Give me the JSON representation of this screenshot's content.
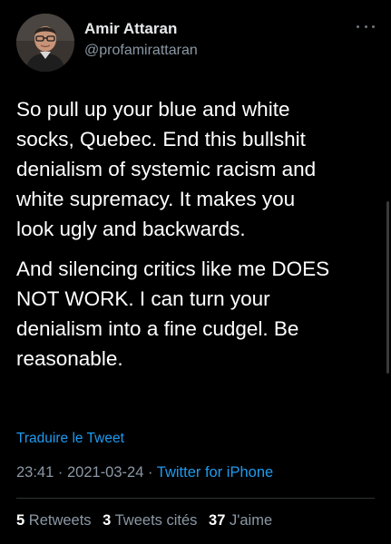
{
  "author": {
    "name": "Amir Attaran",
    "handle": "@profamirattaran"
  },
  "tweet": {
    "paragraphs": [
      "So pull up your blue and white\nsocks, Quebec.  End this bullshit\ndenialism of systemic racism and\nwhite supremacy.  It makes you\nlook ugly and backwards.",
      "And silencing critics like me DOES\nNOT WORK.  I can turn your\ndenialism into a fine cudgel.  Be\nreasonable."
    ],
    "translate_label": "Traduire le Tweet",
    "time": "23:41",
    "date": "2021-03-24",
    "separator": "·",
    "source": "Twitter for iPhone"
  },
  "stats": {
    "retweets_count": "5",
    "retweets_label": "Retweets",
    "quotes_count": "3",
    "quotes_label": "Tweets cités",
    "likes_count": "37",
    "likes_label": "J'aime"
  },
  "colors": {
    "background": "#000000",
    "text": "#ffffff",
    "muted": "#8b98a5",
    "link": "#1d9bf0"
  },
  "icons": {
    "more": "more-horizontal-icon"
  }
}
